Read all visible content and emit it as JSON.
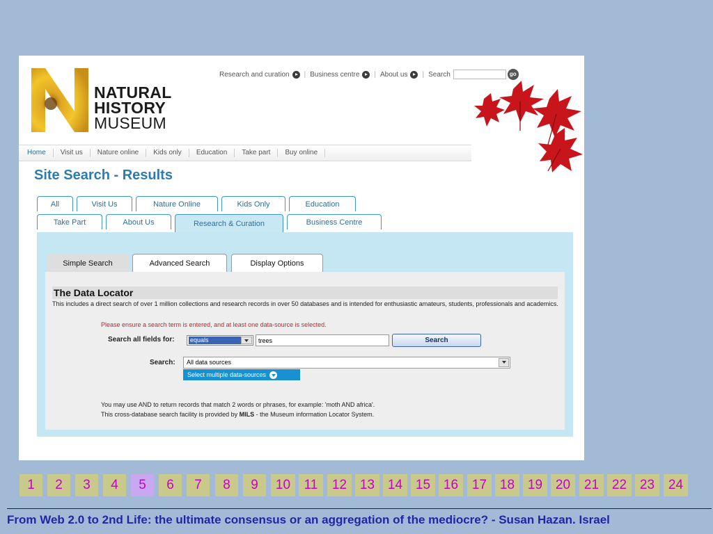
{
  "logo": {
    "line1": "NATURAL",
    "line2": "HISTORY",
    "line3": "MUSEUM"
  },
  "topnav": {
    "links": [
      "Research and curation",
      "Business centre",
      "About us"
    ],
    "search_label": "Search",
    "go_label": "go"
  },
  "mainnav": [
    "Home",
    "Visit us",
    "Nature online",
    "Kids only",
    "Education",
    "Take part",
    "Buy online"
  ],
  "page_title": "Site Search - Results",
  "category_tabs": {
    "row1": [
      "All",
      "Visit Us",
      "Nature Online",
      "Kids Only",
      "Education"
    ],
    "row2": [
      "Take Part",
      "About Us",
      "Research & Curation",
      "Business Centre"
    ],
    "active": "Research & Curation"
  },
  "search_tabs": [
    "Simple Search",
    "Advanced Search",
    "Display Options"
  ],
  "data_locator": {
    "title": "The Data Locator",
    "description": "This includes a direct search of over 1 million collections and research records in over 50 databases and is intended for enthusiastic amateurs, students, professionals and academics.",
    "warning": "Please ensure a search term is entered, and at least one data-source is selected.",
    "search_all_label": "Search all fields for:",
    "match_value": "equals",
    "term_value": "trees",
    "search_button": "Search",
    "sources_label": "Search:",
    "sources_value": "All data sources",
    "multi_button": "Select multiple data-sources",
    "note1": "You may use AND to return records that match 2 words or phrases, for example: 'moth AND africa'.",
    "note2_prefix": "This cross-database search facility is provided by ",
    "note2_bold": "MILS",
    "note2_suffix": " - the Museum information Locator System."
  },
  "slides": [
    "1",
    "2",
    "3",
    "4",
    "5",
    "6",
    "7",
    "8",
    "9",
    "10",
    "11",
    "12",
    "13",
    "14",
    "15",
    "16",
    "17",
    "18",
    "19",
    "20",
    "21",
    "22",
    "23",
    "24"
  ],
  "current_slide": "5",
  "footer": "From Web 2.0 to 2nd Life: the ultimate consensus or an aggregation of the mediocre? - Susan Hazan. Israel",
  "colors": {
    "slide_bg": "#a2bad6",
    "link_blue": "#2e7bb0",
    "panel": "#c4e7f3",
    "pager_bg": "#c9c98c",
    "pager_active": "#c9a8f2",
    "pager_text": "#c800c8",
    "footer_text": "#1f27a6"
  }
}
